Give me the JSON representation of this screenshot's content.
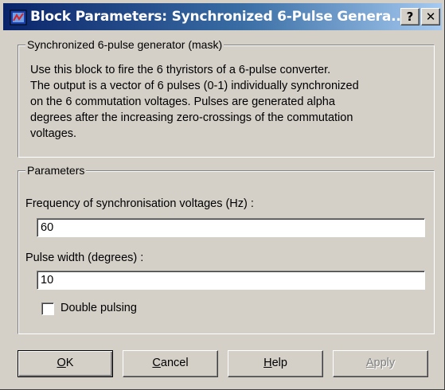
{
  "window": {
    "title": "Block Parameters: Synchronized 6-Pulse Genera...",
    "help_btn": "?",
    "close_btn": "✕"
  },
  "mask": {
    "legend": "Synchronized 6-pulse generator (mask)",
    "description_lines": [
      "Use this block to fire the 6 thyristors of a 6-pulse converter.",
      "The output is a vector of 6 pulses (0-1) individually synchronized",
      "on the 6 commutation voltages. Pulses are generated alpha",
      "degrees after the increasing zero-crossings of the commutation",
      "voltages."
    ]
  },
  "parameters": {
    "legend": "Parameters",
    "frequency": {
      "label": "Frequency of synchronisation voltages (Hz) :",
      "value": "60"
    },
    "pulse_width": {
      "label": "Pulse width (degrees) :",
      "value": "10"
    },
    "double_pulsing": {
      "label": "Double pulsing",
      "checked": false
    }
  },
  "buttons": {
    "ok": {
      "mnemonic": "O",
      "rest": "K"
    },
    "cancel": {
      "mnemonic": "C",
      "rest": "ancel"
    },
    "help": {
      "mnemonic": "H",
      "rest": "elp"
    },
    "apply": {
      "mnemonic": "A",
      "rest": "pply"
    }
  },
  "colors": {
    "titlebar_start": "#0a246a",
    "titlebar_end": "#a6caf0",
    "face": "#d4d0c8"
  }
}
